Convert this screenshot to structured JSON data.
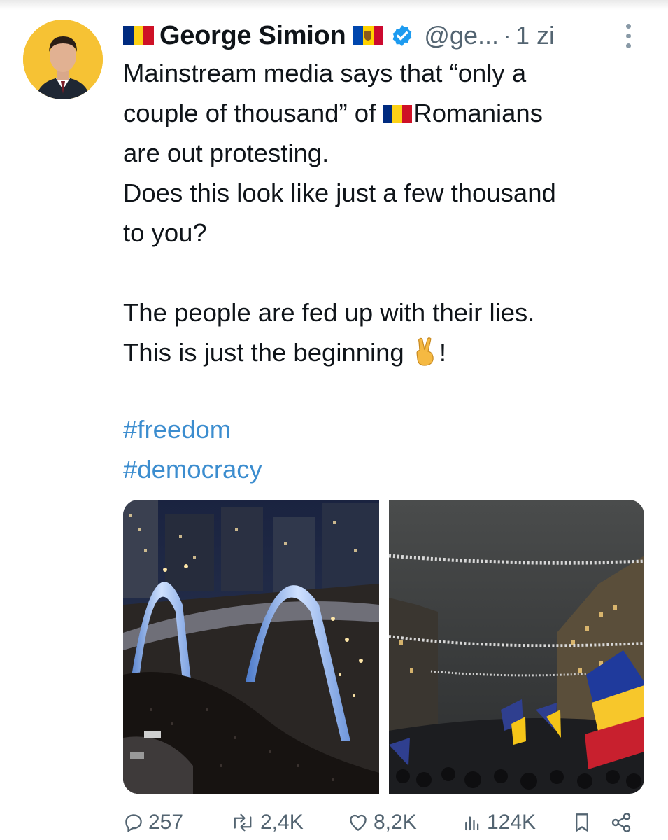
{
  "tweet": {
    "author_name": "George Simion",
    "handle": "@ge...",
    "separator": "·",
    "time": "1 zi",
    "lines": {
      "l1": "Mainstream media says that “only a",
      "l2a": "couple of thousand” of ",
      "l2b": "Romanians",
      "l3": "are out protesting.",
      "l4": "Does this look like just a few thousand",
      "l5": "to you?",
      "l6": "The people are fed up with their lies.",
      "l7a": "This is just the beginning ",
      "l7b": "!"
    },
    "hashtags": [
      "#freedom",
      "#democracy"
    ]
  },
  "metrics": {
    "replies": "257",
    "reposts": "2,4K",
    "likes": "8,2K",
    "views": "124K"
  },
  "icons": [
    "verified-badge-icon",
    "more-options-icon",
    "reply-icon",
    "repost-icon",
    "like-icon",
    "views-icon",
    "bookmark-icon",
    "share-icon",
    "victory-hand-emoji"
  ],
  "colors": {
    "link": "#3c8dcf",
    "verified": "#1d9bf0",
    "muted": "#536471",
    "romania_flag": [
      "#002b7f",
      "#fcd116",
      "#ce1126"
    ]
  }
}
